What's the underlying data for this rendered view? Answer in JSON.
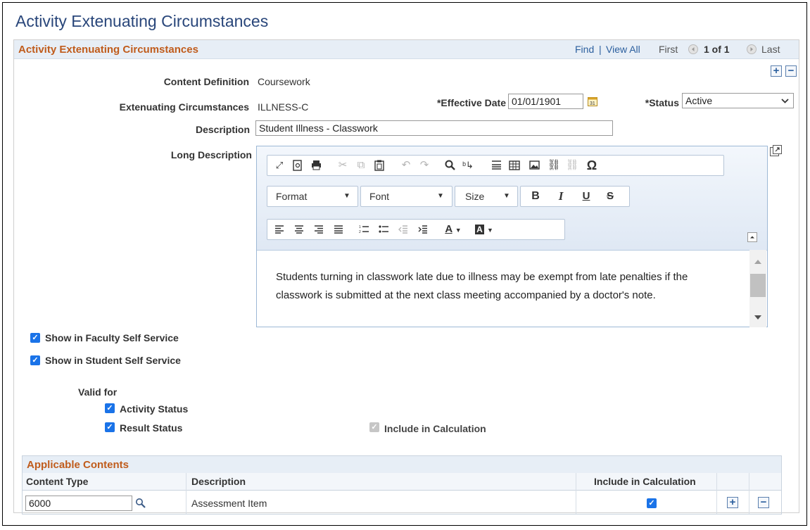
{
  "page_title": "Activity Extenuating Circumstances",
  "panel": {
    "title": "Activity Extenuating Circumstances",
    "find": "Find",
    "separator": "|",
    "view_all": "View All",
    "first": "First",
    "position": "1 of 1",
    "last": "Last"
  },
  "fields": {
    "content_definition_label": "Content Definition",
    "content_definition_value": "Coursework",
    "extenuating_label": "Extenuating Circumstances",
    "extenuating_value": "ILLNESS-C",
    "effective_date_label": "*Effective Date",
    "effective_date_value": "01/01/1901",
    "status_label": "*Status",
    "status_value": "Active",
    "description_label": "Description",
    "description_value": "Student Illness - Classwork",
    "long_description_label": "Long Description"
  },
  "editor": {
    "format_label": "Format",
    "font_label": "Font",
    "size_label": "Size",
    "content": "Students turning in classwork late due to illness may be exempt from late penalties if the classwork is submitted at the next class meeting accompanied by a doctor's note."
  },
  "checkboxes": {
    "faculty": "Show in Faculty Self Service",
    "student": "Show in Student Self Service",
    "valid_for": "Valid for",
    "activity_status": "Activity Status",
    "result_status": "Result Status",
    "include_calc": "Include in Calculation"
  },
  "grid": {
    "title": "Applicable Contents",
    "columns": [
      "Content Type",
      "Description",
      "Include in Calculation"
    ],
    "rows": [
      {
        "content_type": "6000",
        "description": "Assessment Item",
        "include": true
      }
    ]
  },
  "colors": {
    "title_blue": "#29467a",
    "section_orange": "#c05c1c",
    "checkbox_blue": "#1a73e8"
  },
  "icons": [
    "calendar-icon",
    "search-icon",
    "add-icon",
    "remove-icon",
    "expand-icon",
    "chevron-down-icon"
  ]
}
